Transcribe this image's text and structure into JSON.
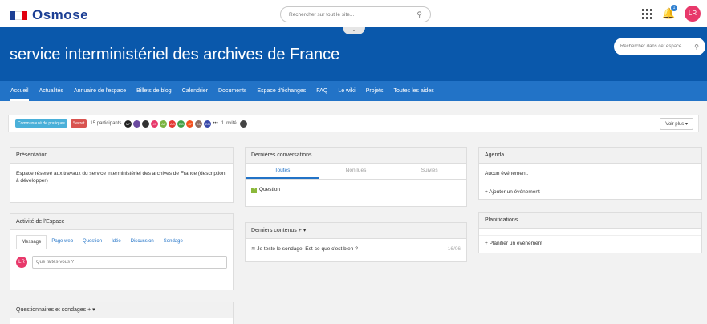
{
  "header": {
    "brand": "Osmose",
    "search_placeholder": "Rechercher sur tout le site...",
    "notif_count": "1",
    "user_initials": "LR",
    "flag_colors": [
      "#1c3f94",
      "#ffffff",
      "#e1000f"
    ]
  },
  "banner": {
    "title": "service interministériel des archives de France",
    "space_search_placeholder": "Rechercher dans cet espace..."
  },
  "nav": {
    "items": [
      "Accueil",
      "Actualités",
      "Annuaire de l'espace",
      "Billets de blog",
      "Calendrier",
      "Documents",
      "Espace d'échanges",
      "FAQ",
      "Le wiki",
      "Projets",
      "Toutes les aides"
    ]
  },
  "info": {
    "tag1": "Communauté de pratiques",
    "tag2": "Secret",
    "participants": "15 participants",
    "invited": "1 invité",
    "avatars": [
      "MP",
      "",
      "",
      "JS",
      "AF",
      "AG",
      "BG",
      "CF",
      "DM",
      "DN"
    ],
    "voir_plus": "Voir plus ▾"
  },
  "presentation": {
    "title": "Présentation",
    "text": "Espace réservé aux travaux du service interministériel des archives de France (description à développer)"
  },
  "activity": {
    "title": "Activité de l'Espace",
    "tabs": [
      "Message",
      "Page web",
      "Question",
      "Idée",
      "Discussion",
      "Sondage"
    ],
    "avatar": "LR",
    "input_placeholder": "Que faites-vous ?"
  },
  "polls": {
    "title": "Questionnaires et sondages"
  },
  "conversations": {
    "title": "Dernières conversations",
    "tabs": [
      "Toutes",
      "Non lues",
      "Suivies"
    ],
    "item": "Question"
  },
  "contents": {
    "title": "Derniers contenus",
    "item": "Je teste le sondage. Est-ce que c'est bien ?",
    "date": "16/06"
  },
  "agenda": {
    "title": "Agenda",
    "empty": "Aucun événement.",
    "add": "+ Ajouter un événement"
  },
  "planning": {
    "title": "Planifications",
    "add": "+ Planifier un événement"
  }
}
